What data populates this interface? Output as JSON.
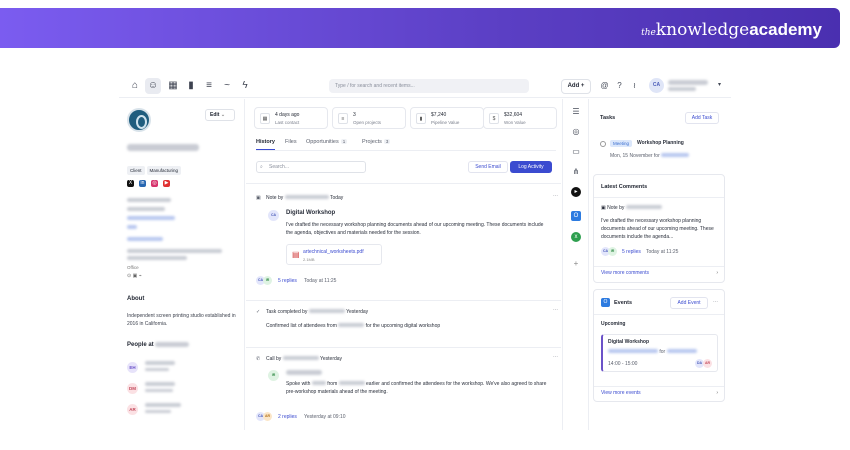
{
  "brand": {
    "prefix": "the",
    "knowledge": "knowledge",
    "academy": "academy"
  },
  "topbar": {
    "search_placeholder": "Type  /  for search and recent items...",
    "add_label": "Add +",
    "avatar_initials": "CA"
  },
  "company": {
    "edit_label": "Edit",
    "tags": [
      "Client",
      "Manufacturing"
    ],
    "office_label": "Office",
    "about_title": "About",
    "about_text": "Independent screen printing studio established in 2016 in California.",
    "people_title": "People at",
    "people": [
      {
        "initials": "EH",
        "color": "#e7e3fa",
        "text": "#6b52c8"
      },
      {
        "initials": "DM",
        "color": "#fbe1e4",
        "text": "#c2485a"
      },
      {
        "initials": "AR",
        "color": "#fbe1e4",
        "text": "#c2485a"
      }
    ]
  },
  "stats": [
    {
      "icon": "calendar-icon",
      "value": "4 days ago",
      "label": "Last contact"
    },
    {
      "icon": "list-icon",
      "value": "3",
      "label": "Open projects"
    },
    {
      "icon": "bar-chart-icon",
      "value": "$7,240",
      "label": "Pipeline Value"
    },
    {
      "icon": "dollar-icon",
      "value": "$32,604",
      "label": "Won Value"
    }
  ],
  "tabs": [
    {
      "label": "History",
      "count": ""
    },
    {
      "label": "Files",
      "count": ""
    },
    {
      "label": "Opportunities",
      "count": "1"
    },
    {
      "label": "Projects",
      "count": "3"
    }
  ],
  "history": {
    "search_placeholder": "Search...",
    "send_email": "Send Email",
    "log_activity": "Log Activity",
    "note": {
      "header_prefix": "Note by",
      "header_time": "Today",
      "author_initials": "CA",
      "title": "Digital Workshop",
      "body": "I've drafted the necessary workshop planning documents ahead of our upcoming meeting. These documents include the agenda, objectives and materials needed for the session.",
      "file_name": "artechnical_worksheets.pdf",
      "file_size": "2.1MB",
      "replies": "5 replies",
      "reply_time": "Today at 11:25"
    },
    "task": {
      "header_prefix": "Task completed by",
      "header_time": "Yesterday",
      "body_prefix": "Confirmed list of attendees from",
      "body_suffix": "for the upcoming digital workshop"
    },
    "call": {
      "header_prefix": "Call by",
      "header_time": "Yesterday",
      "author_initials": "IR",
      "body_a": "Spoke with",
      "body_b": "from",
      "body_c": "earlier and confirmed the attendees for the workshop. We've also agreed to share pre-workshop materials ahead of the meeting.",
      "replies": "2 replies",
      "reply_time": "Yesterday at 09:10"
    }
  },
  "tasks": {
    "title": "Tasks",
    "add": "Add Task",
    "item_badge": "Meeting",
    "item_title": "Workshop Planning",
    "item_date": "Mon, 15 November for"
  },
  "comments": {
    "title": "Latest Comments",
    "note_prefix": "Note by",
    "body": "I've drafted the necessary workshop planning documents ahead of our upcoming meeting. These documents include the agenda...",
    "replies": "5 replies",
    "reply_time": "Today at 11:25",
    "view_more": "View more comments"
  },
  "events": {
    "title": "Events",
    "add": "Add Event",
    "section": "Upcoming",
    "event_title": "Digital Workshop",
    "event_for": "for",
    "event_time": "14:00 - 15:00",
    "view_more": "View more events"
  }
}
